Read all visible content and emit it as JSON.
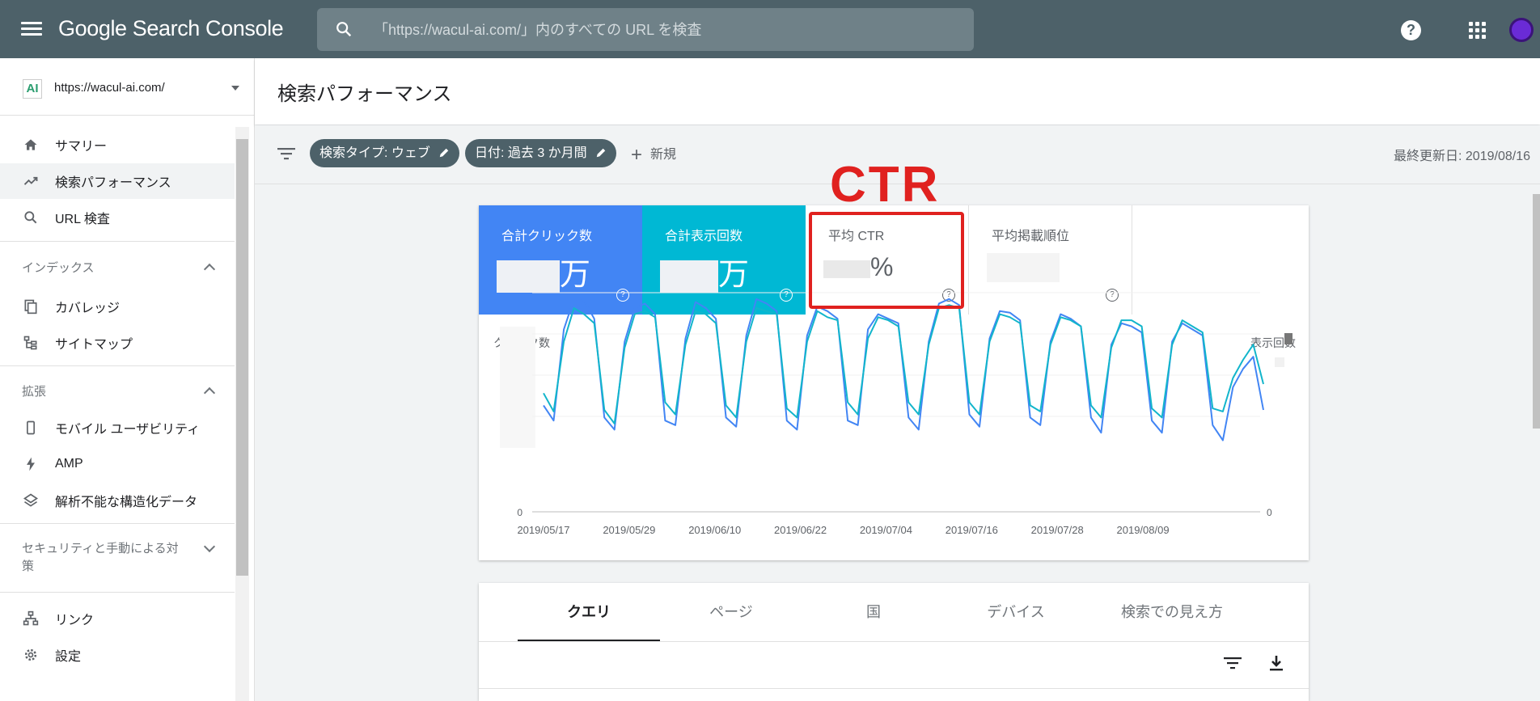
{
  "app": {
    "title": "Google Search Console"
  },
  "search": {
    "placeholder": "「https://wacul-ai.com/」内のすべての URL を検査"
  },
  "property": {
    "logo_text": "AI",
    "url": "https://wacul-ai.com/"
  },
  "sidebar": {
    "items": [
      {
        "label": "サマリー",
        "icon": "home-icon"
      },
      {
        "label": "検索パフォーマンス",
        "icon": "trending-icon",
        "active": true
      },
      {
        "label": "URL 検査",
        "icon": "search-icon"
      }
    ],
    "sections": [
      {
        "title": "インデックス",
        "items": [
          {
            "label": "カバレッジ",
            "icon": "coverage-icon"
          },
          {
            "label": "サイトマップ",
            "icon": "sitemap-icon"
          }
        ]
      },
      {
        "title": "拡張",
        "items": [
          {
            "label": "モバイル ユーザビリティ",
            "icon": "mobile-icon"
          },
          {
            "label": "AMP",
            "icon": "bolt-icon"
          },
          {
            "label": "解析不能な構造化データ",
            "icon": "layers-icon"
          }
        ]
      },
      {
        "title": "セキュリティと手動による対策"
      }
    ],
    "bottom_items": [
      {
        "label": "リンク",
        "icon": "links-icon"
      },
      {
        "label": "設定",
        "icon": "settings-icon"
      }
    ]
  },
  "page": {
    "title": "検索パフォーマンス"
  },
  "filters": {
    "chips": [
      "検索タイプ: ウェブ",
      "日付: 過去 3 か月間"
    ],
    "new_label": "新規",
    "last_updated": "最終更新日: 2019/08/16"
  },
  "annotation": {
    "text": "CTR",
    "color": "#e0211f"
  },
  "metrics": [
    {
      "label": "合計クリック数",
      "suffix": "万",
      "color": "#4285f4"
    },
    {
      "label": "合計表示回数",
      "suffix": "万",
      "color": "#00b8d4"
    },
    {
      "label": "平均 CTR",
      "suffix": "%"
    },
    {
      "label": "平均掲載順位",
      "suffix": ""
    }
  ],
  "chart_data": {
    "type": "line",
    "ylabel_left": "クリック数",
    "ylabel_right": "表示回数",
    "y_left_min": "0",
    "y_right_min": "0",
    "x_ticks": [
      "2019/05/17",
      "2019/05/29",
      "2019/06/10",
      "2019/06/22",
      "2019/07/04",
      "2019/07/16",
      "2019/07/28",
      "2019/08/09"
    ],
    "x_start": "2019/05/17",
    "x_end": "2019/08/15",
    "series": [
      {
        "color": "#4285f4",
        "values": [
          0.28,
          0.18,
          0.78,
          0.98,
          0.97,
          0.85,
          0.2,
          0.12,
          0.7,
          0.92,
          0.95,
          0.88,
          0.18,
          0.15,
          0.72,
          0.96,
          0.92,
          0.85,
          0.2,
          0.14,
          0.74,
          0.98,
          0.95,
          0.9,
          0.18,
          0.12,
          0.74,
          0.93,
          0.9,
          0.85,
          0.18,
          0.15,
          0.78,
          0.88,
          0.85,
          0.82,
          0.2,
          0.12,
          0.7,
          0.95,
          0.98,
          0.94,
          0.22,
          0.14,
          0.72,
          0.9,
          0.89,
          0.84,
          0.2,
          0.15,
          0.7,
          0.88,
          0.85,
          0.8,
          0.2,
          0.1,
          0.68,
          0.82,
          0.8,
          0.76,
          0.18,
          0.1,
          0.7,
          0.82,
          0.78,
          0.74,
          0.15,
          0.05,
          0.4,
          0.52,
          0.6,
          0.25
        ]
      },
      {
        "color": "#12b5cb",
        "values": [
          0.36,
          0.24,
          0.7,
          0.92,
          0.88,
          0.82,
          0.25,
          0.16,
          0.66,
          0.88,
          0.9,
          0.86,
          0.3,
          0.22,
          0.68,
          0.9,
          0.88,
          0.82,
          0.28,
          0.2,
          0.7,
          0.92,
          0.9,
          0.88,
          0.26,
          0.2,
          0.7,
          0.9,
          0.86,
          0.84,
          0.3,
          0.22,
          0.72,
          0.86,
          0.84,
          0.8,
          0.3,
          0.22,
          0.68,
          0.92,
          0.94,
          0.92,
          0.3,
          0.22,
          0.7,
          0.88,
          0.86,
          0.82,
          0.28,
          0.24,
          0.68,
          0.86,
          0.84,
          0.8,
          0.28,
          0.2,
          0.66,
          0.84,
          0.84,
          0.8,
          0.26,
          0.2,
          0.68,
          0.84,
          0.8,
          0.76,
          0.26,
          0.24,
          0.46,
          0.58,
          0.68,
          0.42
        ]
      }
    ]
  },
  "tabs": [
    "クエリ",
    "ページ",
    "国",
    "デバイス",
    "検索での見え方"
  ]
}
